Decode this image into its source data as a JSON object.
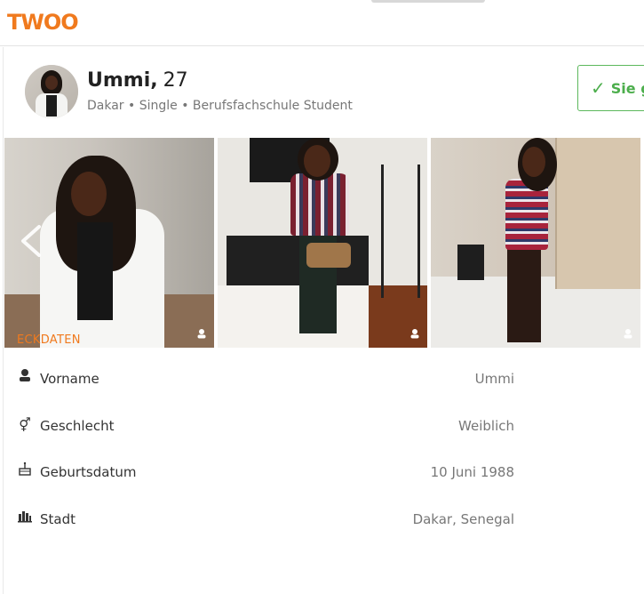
{
  "app": {
    "logo_text": "TWOO",
    "brand_color": "#f07a1e"
  },
  "profile": {
    "name": "Ummi,",
    "age": "27",
    "subline": "Dakar • Single • Berufsfachschule Student"
  },
  "actions": {
    "like_label": "Sie g",
    "like_icon": "check-icon",
    "accent": "#5cb85c"
  },
  "gallery": {
    "prev_icon": "chevron-left-icon",
    "photos": [
      {
        "badge_icon": "user-icon"
      },
      {
        "badge_icon": "user-icon"
      },
      {
        "badge_icon": "user-icon"
      }
    ]
  },
  "details": {
    "title": "ECKDATEN",
    "rows": [
      {
        "icon": "user-icon",
        "label": "Vorname",
        "value": "Ummi"
      },
      {
        "icon": "gender-icon",
        "label": "Geschlecht",
        "value": "Weiblich"
      },
      {
        "icon": "cake-icon",
        "label": "Geburtsdatum",
        "value": "10 Juni 1988"
      },
      {
        "icon": "city-icon",
        "label": "Stadt",
        "value": "Dakar, Senegal"
      }
    ]
  }
}
